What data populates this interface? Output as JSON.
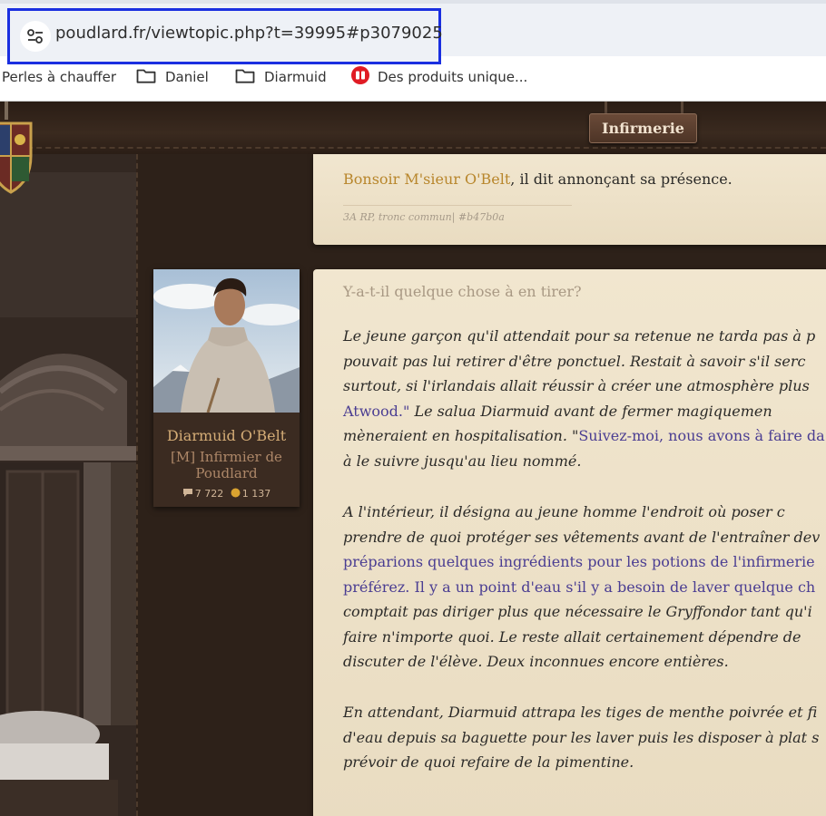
{
  "browser": {
    "url": "poudlard.fr/viewtopic.php?t=39995#p3079025",
    "bookmarks": [
      {
        "label": "Perles à chauffer",
        "icon": "none"
      },
      {
        "label": "Daniel",
        "icon": "folder-icon"
      },
      {
        "label": "Diarmuid",
        "icon": "folder-icon"
      },
      {
        "label": "Des produits unique...",
        "icon": "red-site-icon"
      }
    ]
  },
  "forum": {
    "tab_label": "Infirmerie"
  },
  "post1": {
    "speech": "Bonsoir M'sieur O'Belt",
    "text_after": ", il dit annonçant sa présence.",
    "signature": "3A RP, tronc commun| #b47b0a"
  },
  "profile": {
    "username": "Diarmuid O'Belt",
    "rank_line1": "[M] Infirmier de",
    "rank_line2": "Poudlard",
    "message_count": "7 722",
    "points": "1 137"
  },
  "post2": {
    "title": "Y-a-t-il quelque chose à en tirer?",
    "para1": [
      {
        "t": "Le jeune garçon qu'il attendait pour sa retenue ne tarda pas à p"
      },
      {
        "t": "pouvait pas lui retirer d'être ponctuel. Restait à savoir s'il serc"
      },
      {
        "t": "surtout, si l'irlandais allait réussir à créer une atmosphère plus"
      },
      {
        "s": "Atwood.\"",
        "t": " Le salua Diarmuid avant de fermer magiquemen"
      },
      {
        "t": "mèneraient en hospitalisation. \"",
        "s": "Suivez-moi, nous avons à faire da"
      },
      {
        "t": "à le suivre jusqu'au lieu nommé."
      }
    ],
    "para2": [
      {
        "t": "A l'intérieur, il désigna au jeune homme l'endroit où poser c"
      },
      {
        "t": "prendre de quoi protéger ses vêtements avant de l'entraîner dev"
      },
      {
        "s": "préparions quelques ingrédients pour les potions de l'infirmerie"
      },
      {
        "s": "préférez. Il y a un point d'eau s'il y a besoin de laver quelque ch"
      },
      {
        "t": "comptait pas diriger plus que nécessaire le Gryffondor tant qu'i"
      },
      {
        "t": "faire n'importe quoi. Le reste allait certainement dépendre de"
      },
      {
        "t": "discuter de l'élève. Deux inconnues encore entières."
      }
    ],
    "para3": [
      {
        "t": "En attendant, Diarmuid attrapa les tiges de menthe poivrée et fi"
      },
      {
        "t": "d'eau depuis sa baguette pour les laver puis les disposer à plat s"
      },
      {
        "t": "prévoir de quoi refaire de la pimentine."
      }
    ]
  },
  "colors": {
    "speech_gold": "#b8862c",
    "speech_purple": "#4a3d92",
    "parchment": "#f1e6cf",
    "frame_dark": "#2d2119",
    "url_highlight": "#1a2fe0"
  }
}
